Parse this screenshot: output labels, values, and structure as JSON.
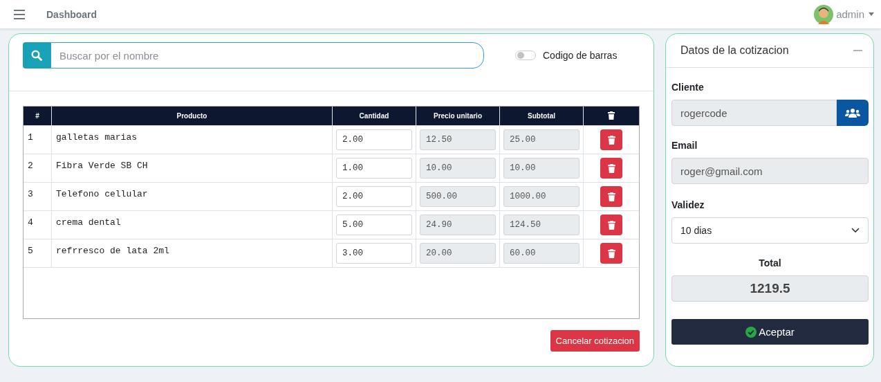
{
  "navbar": {
    "title": "Dashboard",
    "user": "admin"
  },
  "search": {
    "placeholder": "Buscar por el nombre"
  },
  "barcode_toggle": {
    "label": "Codigo de barras",
    "on": false
  },
  "table": {
    "columns": [
      "#",
      "Producto",
      "Cantidad",
      "Precio unitario",
      "Subtotal"
    ],
    "rows": [
      {
        "index": "1",
        "producto": "galletas marias",
        "cantidad": "2.00",
        "precio_unitario": "12.50",
        "subtotal": "25.00"
      },
      {
        "index": "2",
        "producto": "Fibra Verde SB CH",
        "cantidad": "1.00",
        "precio_unitario": "10.00",
        "subtotal": "10.00"
      },
      {
        "index": "3",
        "producto": "Telefono cellular",
        "cantidad": "2.00",
        "precio_unitario": "500.00",
        "subtotal": "1000.00"
      },
      {
        "index": "4",
        "producto": "crema dental",
        "cantidad": "5.00",
        "precio_unitario": "24.90",
        "subtotal": "124.50"
      },
      {
        "index": "5",
        "producto": "refrresco de lata 2ml",
        "cantidad": "3.00",
        "precio_unitario": "20.00",
        "subtotal": "60.00"
      }
    ]
  },
  "cancel_button": "Cancelar cotizacion",
  "quote_panel": {
    "title": "Datos de la cotizacion",
    "cliente_label": "Cliente",
    "cliente_value": "rogercode",
    "email_label": "Email",
    "email_value": "roger@gmail.com",
    "validez_label": "Validez",
    "validez_value": "10 dias",
    "total_label": "Total",
    "total_value": "1219.5",
    "accept_button": "Aceptar"
  }
}
